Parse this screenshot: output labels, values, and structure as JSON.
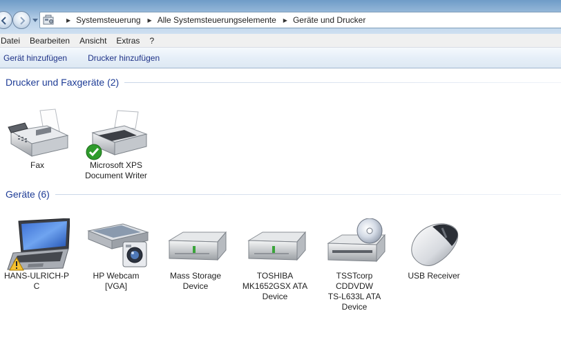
{
  "address_bar": {
    "breadcrumbs": [
      "Systemsteuerung",
      "Alle Systemsteuerungselemente",
      "Geräte und Drucker"
    ]
  },
  "menu": {
    "items": [
      "Datei",
      "Bearbeiten",
      "Ansicht",
      "Extras",
      "?"
    ]
  },
  "commands": {
    "add_device": "Gerät hinzufügen",
    "add_printer": "Drucker hinzufügen"
  },
  "groups": {
    "printers": {
      "title": "Drucker und Faxgeräte (2)",
      "items": [
        {
          "label": "Fax",
          "icon": "fax-icon"
        },
        {
          "label": "Microsoft XPS\nDocument Writer",
          "icon": "printer-icon",
          "badge": "default-check"
        }
      ]
    },
    "devices": {
      "title": "Geräte (6)",
      "items": [
        {
          "label": "HANS-ULRICH-P\nC",
          "icon": "laptop-icon",
          "badge": "warning"
        },
        {
          "label": "HP Webcam\n[VGA]",
          "icon": "scanner-camera-icon"
        },
        {
          "label": "Mass Storage\nDevice",
          "icon": "drive-icon"
        },
        {
          "label": "TOSHIBA\nMK1652GSX ATA\nDevice",
          "icon": "drive-icon"
        },
        {
          "label": "TSSTcorp\nCDDVDW\nTS-L633L ATA\nDevice",
          "icon": "optical-drive-icon"
        },
        {
          "label": "USB Receiver",
          "icon": "mouse-icon"
        }
      ]
    }
  },
  "colors": {
    "link_blue": "#1e3287",
    "group_header_blue": "#1e3c96"
  }
}
